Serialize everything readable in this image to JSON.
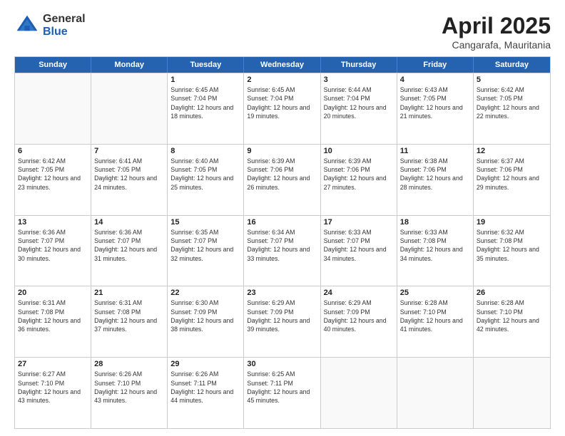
{
  "logo": {
    "general": "General",
    "blue": "Blue"
  },
  "title": {
    "month": "April 2025",
    "location": "Cangarafa, Mauritania"
  },
  "header_days": [
    "Sunday",
    "Monday",
    "Tuesday",
    "Wednesday",
    "Thursday",
    "Friday",
    "Saturday"
  ],
  "weeks": [
    [
      {
        "day": "",
        "empty": true
      },
      {
        "day": "",
        "empty": true
      },
      {
        "day": "1",
        "sunrise": "6:45 AM",
        "sunset": "7:04 PM",
        "daylight": "12 hours and 18 minutes."
      },
      {
        "day": "2",
        "sunrise": "6:45 AM",
        "sunset": "7:04 PM",
        "daylight": "12 hours and 19 minutes."
      },
      {
        "day": "3",
        "sunrise": "6:44 AM",
        "sunset": "7:04 PM",
        "daylight": "12 hours and 20 minutes."
      },
      {
        "day": "4",
        "sunrise": "6:43 AM",
        "sunset": "7:05 PM",
        "daylight": "12 hours and 21 minutes."
      },
      {
        "day": "5",
        "sunrise": "6:42 AM",
        "sunset": "7:05 PM",
        "daylight": "12 hours and 22 minutes."
      }
    ],
    [
      {
        "day": "6",
        "sunrise": "6:42 AM",
        "sunset": "7:05 PM",
        "daylight": "12 hours and 23 minutes."
      },
      {
        "day": "7",
        "sunrise": "6:41 AM",
        "sunset": "7:05 PM",
        "daylight": "12 hours and 24 minutes."
      },
      {
        "day": "8",
        "sunrise": "6:40 AM",
        "sunset": "7:05 PM",
        "daylight": "12 hours and 25 minutes."
      },
      {
        "day": "9",
        "sunrise": "6:39 AM",
        "sunset": "7:06 PM",
        "daylight": "12 hours and 26 minutes."
      },
      {
        "day": "10",
        "sunrise": "6:39 AM",
        "sunset": "7:06 PM",
        "daylight": "12 hours and 27 minutes."
      },
      {
        "day": "11",
        "sunrise": "6:38 AM",
        "sunset": "7:06 PM",
        "daylight": "12 hours and 28 minutes."
      },
      {
        "day": "12",
        "sunrise": "6:37 AM",
        "sunset": "7:06 PM",
        "daylight": "12 hours and 29 minutes."
      }
    ],
    [
      {
        "day": "13",
        "sunrise": "6:36 AM",
        "sunset": "7:07 PM",
        "daylight": "12 hours and 30 minutes."
      },
      {
        "day": "14",
        "sunrise": "6:36 AM",
        "sunset": "7:07 PM",
        "daylight": "12 hours and 31 minutes."
      },
      {
        "day": "15",
        "sunrise": "6:35 AM",
        "sunset": "7:07 PM",
        "daylight": "12 hours and 32 minutes."
      },
      {
        "day": "16",
        "sunrise": "6:34 AM",
        "sunset": "7:07 PM",
        "daylight": "12 hours and 33 minutes."
      },
      {
        "day": "17",
        "sunrise": "6:33 AM",
        "sunset": "7:07 PM",
        "daylight": "12 hours and 34 minutes."
      },
      {
        "day": "18",
        "sunrise": "6:33 AM",
        "sunset": "7:08 PM",
        "daylight": "12 hours and 34 minutes."
      },
      {
        "day": "19",
        "sunrise": "6:32 AM",
        "sunset": "7:08 PM",
        "daylight": "12 hours and 35 minutes."
      }
    ],
    [
      {
        "day": "20",
        "sunrise": "6:31 AM",
        "sunset": "7:08 PM",
        "daylight": "12 hours and 36 minutes."
      },
      {
        "day": "21",
        "sunrise": "6:31 AM",
        "sunset": "7:08 PM",
        "daylight": "12 hours and 37 minutes."
      },
      {
        "day": "22",
        "sunrise": "6:30 AM",
        "sunset": "7:09 PM",
        "daylight": "12 hours and 38 minutes."
      },
      {
        "day": "23",
        "sunrise": "6:29 AM",
        "sunset": "7:09 PM",
        "daylight": "12 hours and 39 minutes."
      },
      {
        "day": "24",
        "sunrise": "6:29 AM",
        "sunset": "7:09 PM",
        "daylight": "12 hours and 40 minutes."
      },
      {
        "day": "25",
        "sunrise": "6:28 AM",
        "sunset": "7:10 PM",
        "daylight": "12 hours and 41 minutes."
      },
      {
        "day": "26",
        "sunrise": "6:28 AM",
        "sunset": "7:10 PM",
        "daylight": "12 hours and 42 minutes."
      }
    ],
    [
      {
        "day": "27",
        "sunrise": "6:27 AM",
        "sunset": "7:10 PM",
        "daylight": "12 hours and 43 minutes."
      },
      {
        "day": "28",
        "sunrise": "6:26 AM",
        "sunset": "7:10 PM",
        "daylight": "12 hours and 43 minutes."
      },
      {
        "day": "29",
        "sunrise": "6:26 AM",
        "sunset": "7:11 PM",
        "daylight": "12 hours and 44 minutes."
      },
      {
        "day": "30",
        "sunrise": "6:25 AM",
        "sunset": "7:11 PM",
        "daylight": "12 hours and 45 minutes."
      },
      {
        "day": "",
        "empty": true
      },
      {
        "day": "",
        "empty": true
      },
      {
        "day": "",
        "empty": true
      }
    ]
  ]
}
